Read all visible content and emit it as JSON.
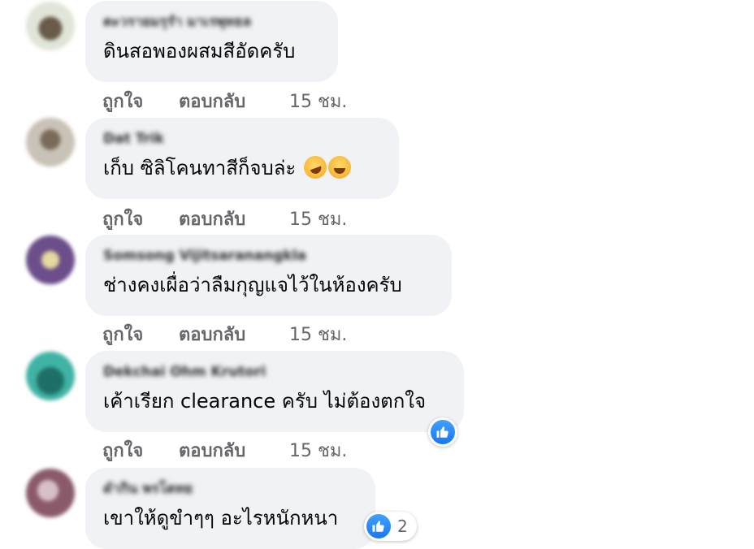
{
  "comments": [
    {
      "author": "ตะวรายมรุรำ มาเรพุทธล",
      "text": "ดินสอพองผสมสีอัดครับ",
      "like_label": "ถูกใจ",
      "reply_label": "ตอบกลับ",
      "time": "15 ชม.",
      "avatar_color": "#cfd6c8"
    },
    {
      "author": "Dat Trik",
      "text": "เก็บ ซิลิโคนทาสีก็จบล่ะ",
      "like_label": "ถูกใจ",
      "reply_label": "ตอบกลับ",
      "time": "15 ชม.",
      "avatar_color": "#b8b3aa",
      "emojis": [
        "rolling-on-floor-laughing-emoji",
        "tears-of-joy-emoji"
      ]
    },
    {
      "author": "Somsong Vijitsaranangkla",
      "text": "ช่างคงเผื่อว่าลืมกุญแจไว้ในห้องครับ",
      "like_label": "ถูกใจ",
      "reply_label": "ตอบกลับ",
      "time": "15 ชม.",
      "avatar_color": "#6b4e8a"
    },
    {
      "author": "Dekchai Ohm Krutori",
      "text": "เค้าเรียก clearance ครับ ไม่ต้องตกใจ",
      "like_label": "ถูกใจ",
      "reply_label": "ตอบกลับ",
      "time": "15 ชม.",
      "avatar_color": "#2a9a8e",
      "reaction": {
        "icon": "like-icon",
        "count": ""
      }
    },
    {
      "author": "ดำกิน พรโตทย",
      "text": "เขาให้ดูขำๆๆ อะไรหนักหนา",
      "avatar_color": "#8a5a6a",
      "reaction": {
        "icon": "like-icon",
        "count": "2"
      }
    }
  ],
  "colors": {
    "bubble": "#f0f2f5",
    "meta": "#65676b",
    "like_blue": "#1877f2"
  }
}
